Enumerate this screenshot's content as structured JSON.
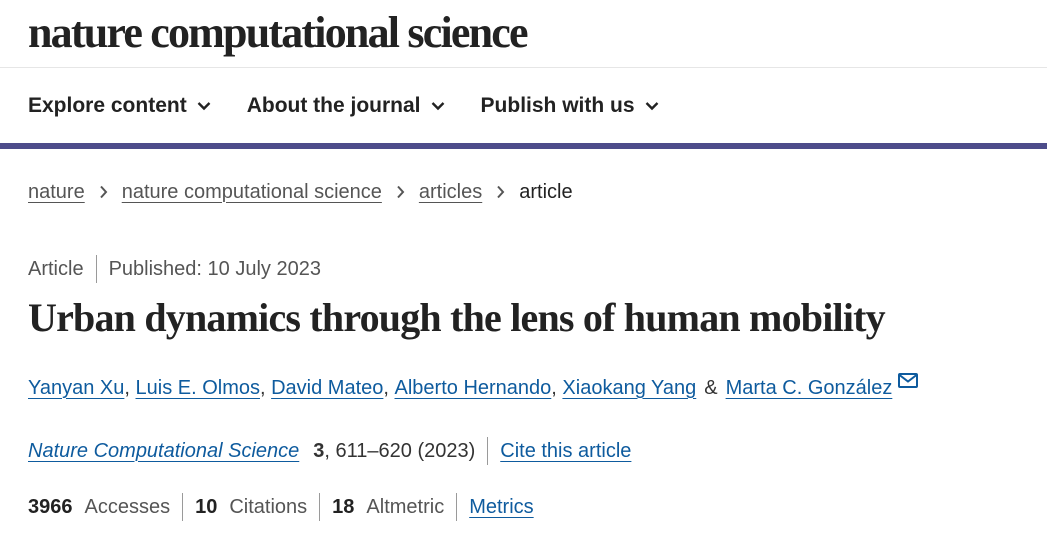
{
  "brand": {
    "name": "nature computational science"
  },
  "nav": {
    "items": [
      {
        "label": "Explore content"
      },
      {
        "label": "About the journal"
      },
      {
        "label": "Publish with us"
      }
    ]
  },
  "breadcrumb": {
    "items": [
      "nature",
      "nature computational science",
      "articles"
    ],
    "current": "article"
  },
  "article": {
    "type": "Article",
    "published": "Published: 10 July 2023",
    "title": "Urban dynamics through the lens of human mobility",
    "authors": [
      "Yanyan Xu",
      "Luis E. Olmos",
      "David Mateo",
      "Alberto Hernando",
      "Xiaokang Yang",
      "Marta C. González"
    ],
    "author_sep": ",",
    "author_amp": "&",
    "journal": "Nature Computational Science",
    "volume": "3",
    "pages_year": ", 611–620 (2023)",
    "cite_label": "Cite this article"
  },
  "metrics": {
    "accesses_count": "3966",
    "accesses_label": "Accesses",
    "citations_count": "10",
    "citations_label": "Citations",
    "altmetric_count": "18",
    "altmetric_label": "Altmetric",
    "metrics_link": "Metrics"
  },
  "colors": {
    "accent_bar": "#4d4c8a",
    "link": "#0e5b9e",
    "text": "#222222",
    "muted": "#555555"
  }
}
